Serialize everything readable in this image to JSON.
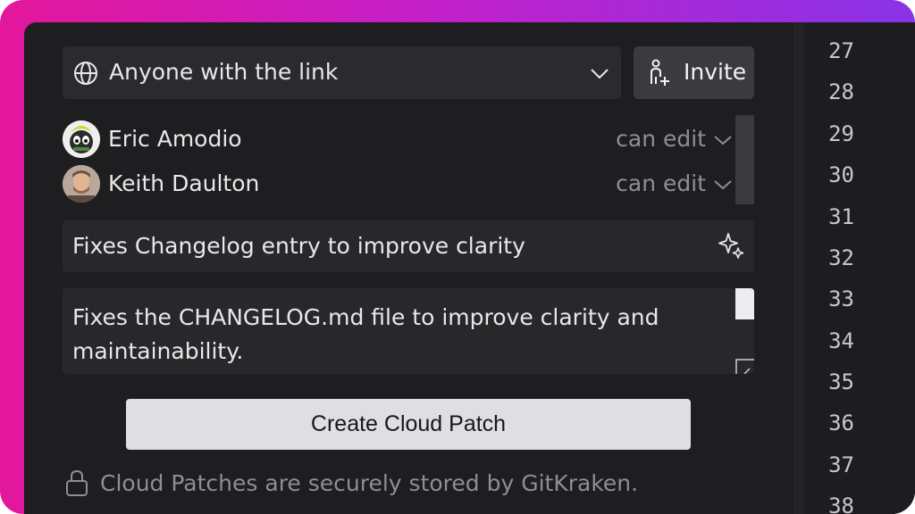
{
  "share": {
    "access_icon": "globe-icon",
    "access_label": "Anyone with the link",
    "invite_icon": "person-add-icon",
    "invite_label": "Invite"
  },
  "users": [
    {
      "name": "Eric Amodio",
      "permission": "can edit"
    },
    {
      "name": "Keith Daulton",
      "permission": "can edit"
    }
  ],
  "patch": {
    "title": "Fixes Changelog entry to improve clarity",
    "title_action_icon": "sparkle-icon",
    "description": "Fixes the CHANGELOG.md file to improve clarity and maintainability."
  },
  "create_label": "Create Cloud Patch",
  "footer": {
    "icon": "lock-icon",
    "text": "Cloud Patches are securely stored by GitKraken."
  },
  "editor": {
    "line_numbers": [
      "27",
      "28",
      "29",
      "30",
      "31",
      "32",
      "33",
      "34",
      "35",
      "36",
      "37",
      "38"
    ]
  },
  "colors": {
    "background_gradient": [
      "#e3179b",
      "#8a33e8"
    ],
    "panel": "#1e1e20",
    "button_primary": "#dedee3"
  }
}
